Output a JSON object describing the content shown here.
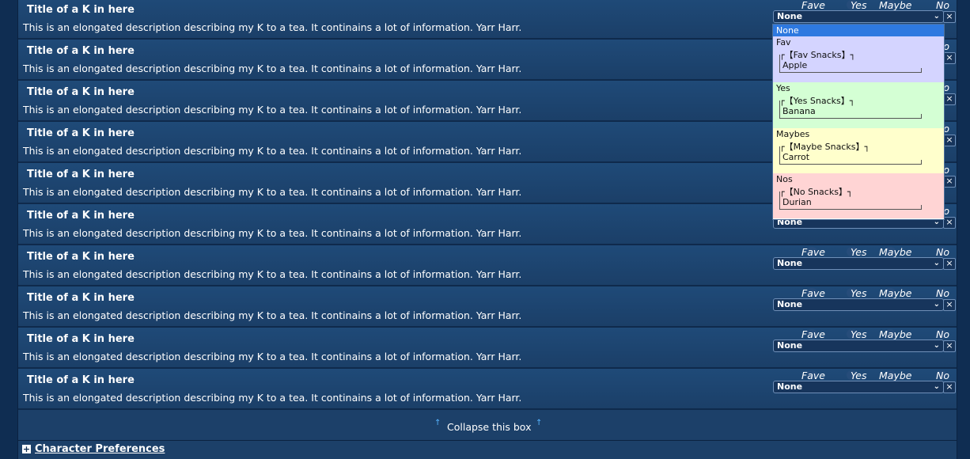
{
  "rows": [
    {
      "title": "Title of a K in here",
      "desc": "This is an elongated description describing my K to a tea. It continains a lot of information. Yarr Harr.",
      "selected": "None"
    },
    {
      "title": "Title of a K in here",
      "desc": "This is an elongated description describing my K to a tea. It continains a lot of information. Yarr Harr.",
      "selected": "None"
    },
    {
      "title": "Title of a K in here",
      "desc": "This is an elongated description describing my K to a tea. It continains a lot of information. Yarr Harr.",
      "selected": "None"
    },
    {
      "title": "Title of a K in here",
      "desc": "This is an elongated description describing my K to a tea. It continains a lot of information. Yarr Harr.",
      "selected": "None"
    },
    {
      "title": "Title of a K in here",
      "desc": "This is an elongated description describing my K to a tea. It continains a lot of information. Yarr Harr.",
      "selected": "None"
    },
    {
      "title": "Title of a K in here",
      "desc": "This is an elongated description describing my K to a tea. It continains a lot of information. Yarr Harr.",
      "selected": "None"
    },
    {
      "title": "Title of a K in here",
      "desc": "This is an elongated description describing my K to a tea. It continains a lot of information. Yarr Harr.",
      "selected": "None"
    },
    {
      "title": "Title of a K in here",
      "desc": "This is an elongated description describing my K to a tea. It continains a lot of information. Yarr Harr.",
      "selected": "None"
    },
    {
      "title": "Title of a K in here",
      "desc": "This is an elongated description describing my K to a tea. It continains a lot of information. Yarr Harr.",
      "selected": "None"
    },
    {
      "title": "Title of a K in here",
      "desc": "This is an elongated description describing my K to a tea. It continains a lot of information. Yarr Harr.",
      "selected": "None"
    }
  ],
  "pref_labels": {
    "fave": "Fave",
    "yes": "Yes",
    "maybe": "Maybe",
    "no": "No"
  },
  "clear_glyph": "×",
  "chevron": "⌄",
  "dropdown": {
    "highlighted": "None",
    "groups": [
      {
        "label": "Fav",
        "caption": "┌【Fav Snacks】┐",
        "item": "Apple",
        "color": "#d4d4ff"
      },
      {
        "label": "Yes",
        "caption": "┌【Yes Snacks】┐",
        "item": "Banana",
        "color": "#d4ffd4"
      },
      {
        "label": "Maybes",
        "caption": "┌【Maybe Snacks】┐",
        "item": "Carrot",
        "color": "#ffffcc"
      },
      {
        "label": "Nos",
        "caption": "┌【No Snacks】┐",
        "item": "Durian",
        "color": "#ffd4d4"
      }
    ]
  },
  "footer": {
    "collapse_label": "Collapse this box",
    "arrow": "↑",
    "plus": "+",
    "char_prefs": "Character Preferences"
  },
  "colors": {
    "accent": "#2e79e0",
    "arrow": "#56b4ff",
    "row": "#1f4a78"
  }
}
